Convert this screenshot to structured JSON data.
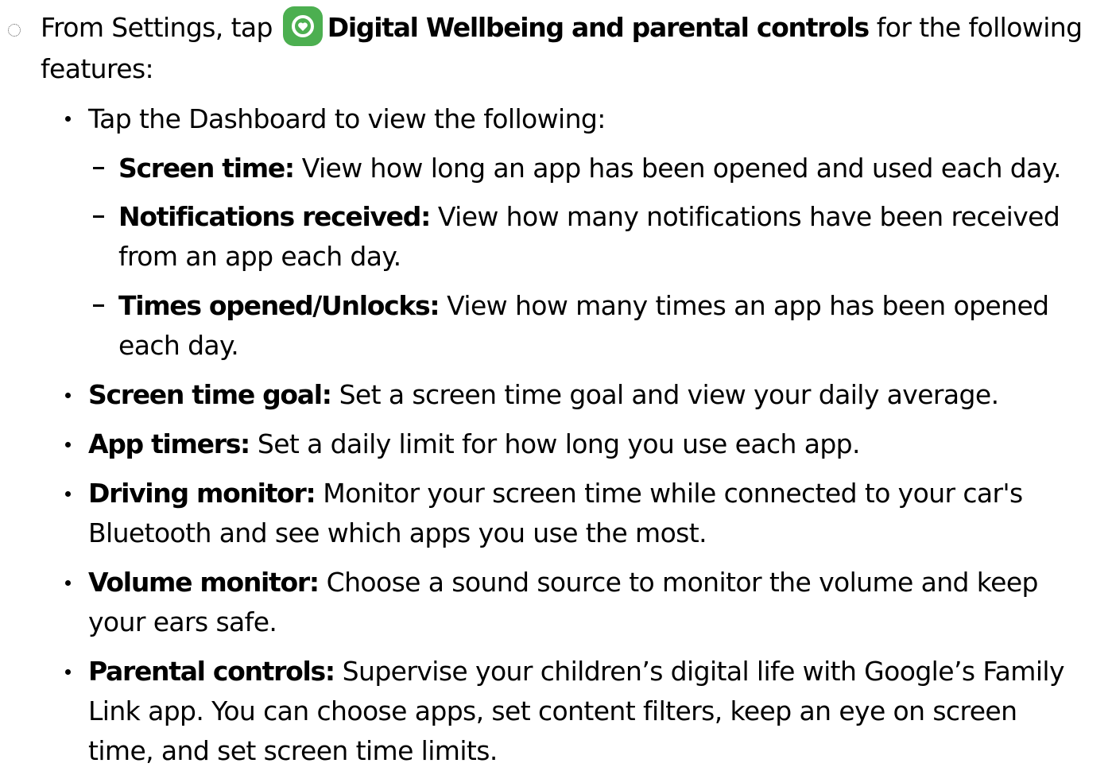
{
  "intro": {
    "text_before": "From Settings, tap",
    "bold": "Digital Wellbeing and parental controls",
    "text_after": "for the following",
    "line2": "features:",
    "icon": "digital-wellbeing-icon",
    "icon_color": "#4caf50"
  },
  "dashboard": {
    "text": "Tap the Dashboard to view the following:",
    "items": [
      {
        "bold": "Screen time:",
        "lines": [
          "View how long an app has been opened and used each day."
        ]
      },
      {
        "bold": "Notifications received:",
        "lines": [
          "View how many notifications have been received",
          "from an app each day."
        ]
      },
      {
        "bold": "Times opened/Unlocks:",
        "lines": [
          "View how many times an app has been opened",
          "each day."
        ]
      }
    ]
  },
  "features": [
    {
      "bold": "Screen time goal:",
      "lines": [
        "Set a screen time goal and view your daily average."
      ]
    },
    {
      "bold": "App timers:",
      "lines": [
        "Set a daily limit for how long you use each app."
      ]
    },
    {
      "bold": "Driving monitor:",
      "lines": [
        "Monitor your screen time while connected to your car's",
        "Bluetooth and see which apps you use the most."
      ]
    },
    {
      "bold": "Volume monitor:",
      "lines": [
        "Choose a sound source to monitor the volume and keep",
        "your ears safe."
      ]
    },
    {
      "bold": "Parental controls:",
      "lines": [
        "Supervise your children’s digital life with Google’s Family",
        "Link app. You can choose apps, set content filters, keep an eye on screen",
        "time, and set screen time limits."
      ]
    }
  ]
}
